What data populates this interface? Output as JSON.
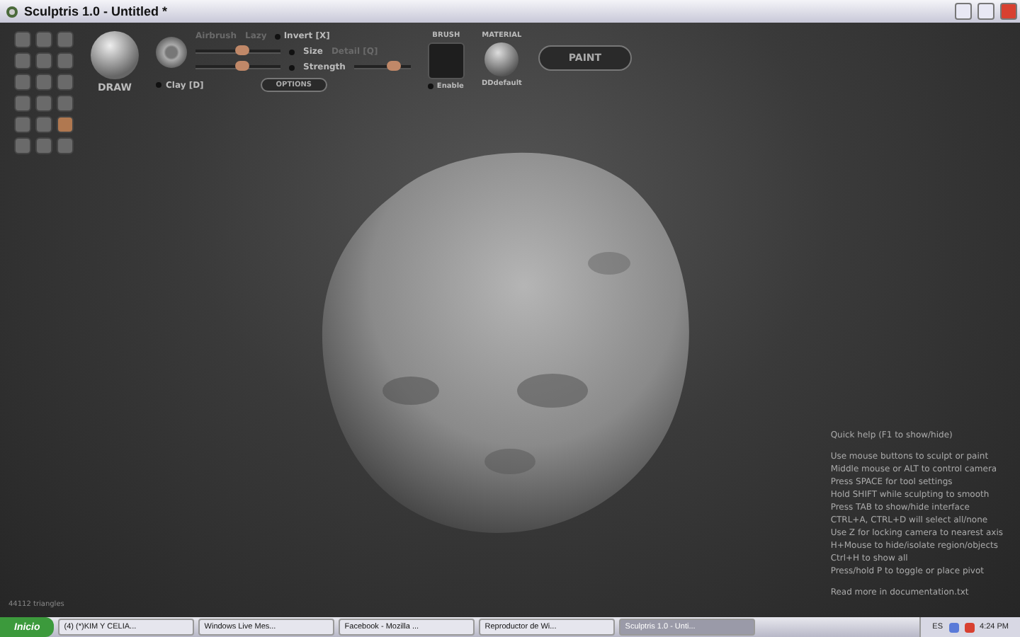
{
  "window": {
    "title": "Sculptris 1.0 - Untitled *"
  },
  "tool_buttons": [
    {
      "selected": false
    },
    {
      "selected": false
    },
    {
      "selected": false
    },
    {
      "selected": false
    },
    {
      "selected": false
    },
    {
      "selected": false
    },
    {
      "selected": false
    },
    {
      "selected": false
    },
    {
      "selected": false
    },
    {
      "selected": false
    },
    {
      "selected": false
    },
    {
      "selected": false
    },
    {
      "selected": false
    },
    {
      "selected": false
    },
    {
      "selected": true
    },
    {
      "selected": false
    },
    {
      "selected": false
    },
    {
      "selected": false
    }
  ],
  "brush_tool": {
    "label": "DRAW"
  },
  "options": [
    {
      "label": "Airbrush",
      "disabled": true
    },
    {
      "label": "Lazy",
      "disabled": true
    },
    {
      "label": "Invert [X]",
      "checked": false,
      "disabled": false
    }
  ],
  "sliders": [
    {
      "label": "Size",
      "level": 0.55
    },
    {
      "label": "Strength",
      "level": 0.55
    }
  ],
  "detail": {
    "label": "Detail [Q]",
    "level": 0.7
  },
  "clay": {
    "label": "Clay [D]",
    "checked": false
  },
  "options_button": "OPTIONS",
  "brush": {
    "heading": "BRUSH",
    "enable_label": "Enable",
    "enabled": false
  },
  "material": {
    "heading": "MATERIAL",
    "name": "DDdefault"
  },
  "paint_button": "PAINT",
  "quick_help": {
    "title": "Quick help (F1 to show/hide)",
    "lines": [
      "Use mouse buttons to sculpt or paint",
      "Middle mouse or ALT to control camera",
      "Press SPACE for tool settings",
      "Hold SHIFT while sculpting to smooth",
      "Press TAB to show/hide interface",
      "CTRL+A, CTRL+D will select all/none",
      "Use Z for locking camera to nearest axis",
      "H+Mouse to hide/isolate region/objects",
      "Ctrl+H to show all",
      "Press/hold P to toggle or place pivot"
    ],
    "footer": "Read more in documentation.txt"
  },
  "status": "44112 triangles",
  "taskbar": {
    "start": "Inicio",
    "tasks": [
      {
        "label": "(4) (*)KIM Y CELIA...",
        "selected": false
      },
      {
        "label": "Windows Live Mes...",
        "selected": false
      },
      {
        "label": "Facebook - Mozilla ...",
        "selected": false
      },
      {
        "label": "Reproductor de Wi...",
        "selected": false
      },
      {
        "label": "Sculptris 1.0 - Unti...",
        "selected": true
      }
    ],
    "language": "ES",
    "time": "4:24 PM"
  }
}
